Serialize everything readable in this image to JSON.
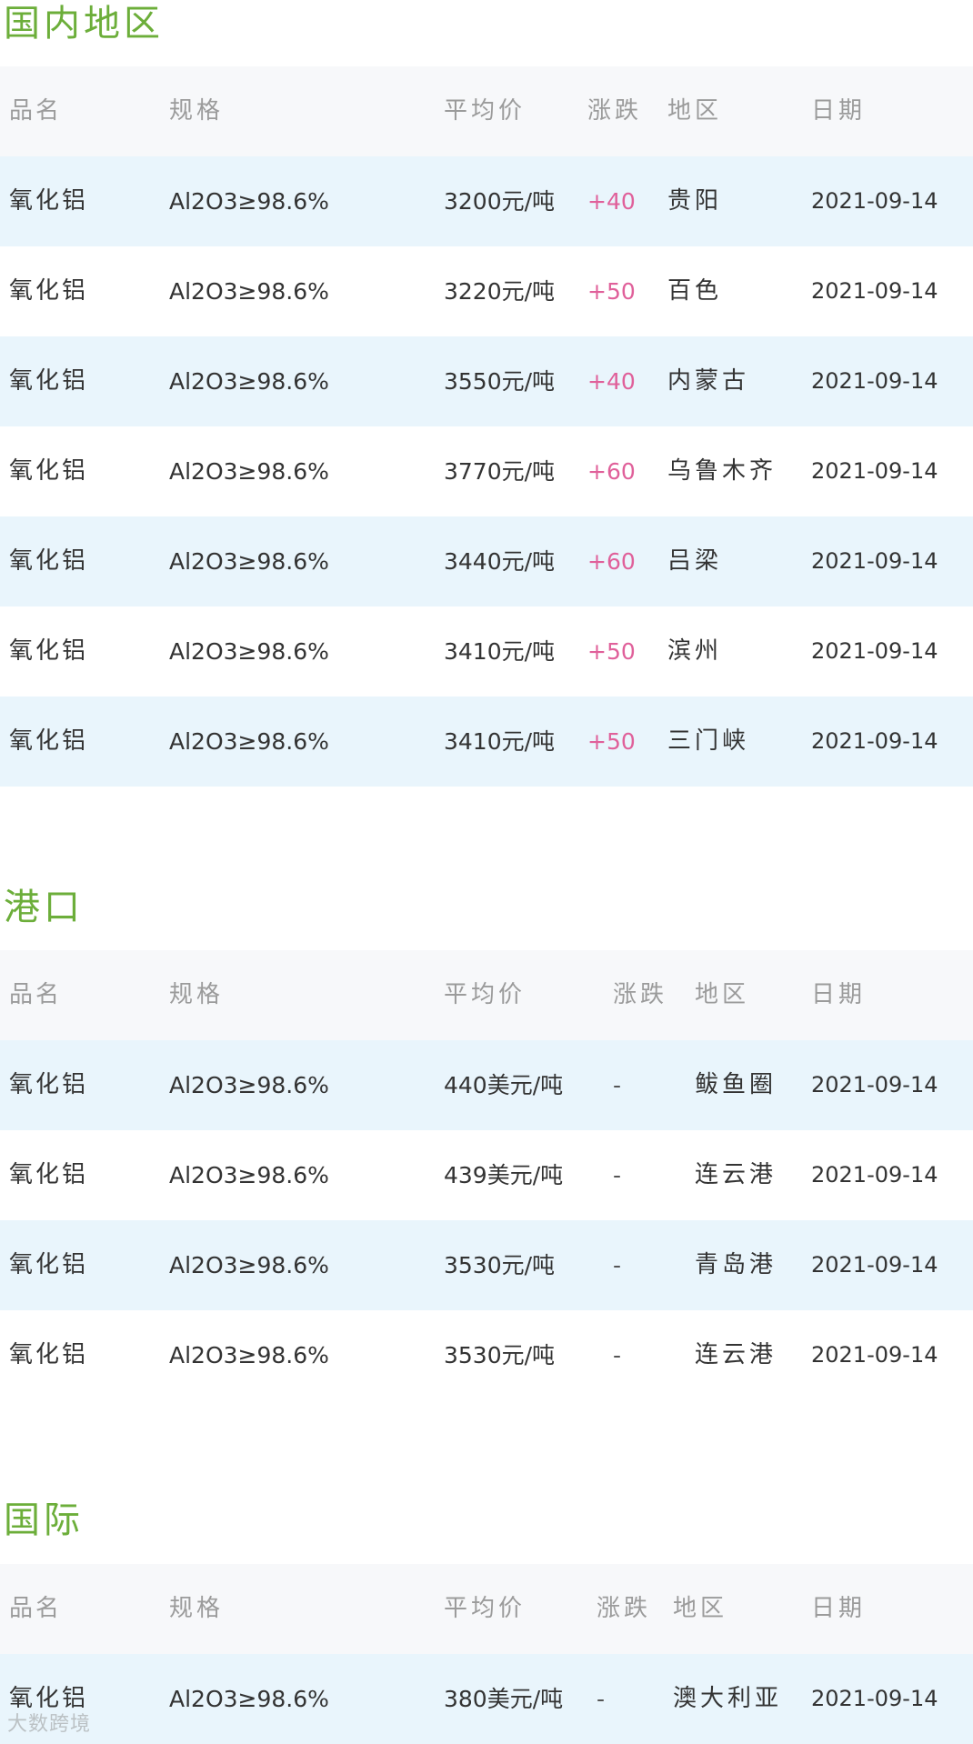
{
  "sections": [
    {
      "title": "国内地区",
      "headers": {
        "name": "品名",
        "spec": "规格",
        "price": "平均价",
        "change": "涨跌",
        "region": "地区",
        "date": "日期"
      },
      "rows": [
        {
          "name": "氧化铝",
          "spec": "Al2O3≥98.6%",
          "price": "3200元/吨",
          "change": "+40",
          "region": "贵阳",
          "date": "2021-09-14"
        },
        {
          "name": "氧化铝",
          "spec": "Al2O3≥98.6%",
          "price": "3220元/吨",
          "change": "+50",
          "region": "百色",
          "date": "2021-09-14"
        },
        {
          "name": "氧化铝",
          "spec": "Al2O3≥98.6%",
          "price": "3550元/吨",
          "change": "+40",
          "region": "内蒙古",
          "date": "2021-09-14"
        },
        {
          "name": "氧化铝",
          "spec": "Al2O3≥98.6%",
          "price": "3770元/吨",
          "change": "+60",
          "region": "乌鲁木齐",
          "date": "2021-09-14"
        },
        {
          "name": "氧化铝",
          "spec": "Al2O3≥98.6%",
          "price": "3440元/吨",
          "change": "+60",
          "region": "吕梁",
          "date": "2021-09-14"
        },
        {
          "name": "氧化铝",
          "spec": "Al2O3≥98.6%",
          "price": "3410元/吨",
          "change": "+50",
          "region": "滨州",
          "date": "2021-09-14"
        },
        {
          "name": "氧化铝",
          "spec": "Al2O3≥98.6%",
          "price": "3410元/吨",
          "change": "+50",
          "region": "三门峡",
          "date": "2021-09-14"
        }
      ]
    },
    {
      "title": "港口",
      "headers": {
        "name": "品名",
        "spec": "规格",
        "price": "平均价",
        "change": "涨跌",
        "region": "地区",
        "date": "日期"
      },
      "rows": [
        {
          "name": "氧化铝",
          "spec": "Al2O3≥98.6%",
          "price": "440美元/吨",
          "change": "-",
          "region": "鲅鱼圈",
          "date": "2021-09-14"
        },
        {
          "name": "氧化铝",
          "spec": "Al2O3≥98.6%",
          "price": "439美元/吨",
          "change": "-",
          "region": "连云港",
          "date": "2021-09-14"
        },
        {
          "name": "氧化铝",
          "spec": "Al2O3≥98.6%",
          "price": "3530元/吨",
          "change": "-",
          "region": "青岛港",
          "date": "2021-09-14"
        },
        {
          "name": "氧化铝",
          "spec": "Al2O3≥98.6%",
          "price": "3530元/吨",
          "change": "-",
          "region": "连云港",
          "date": "2021-09-14"
        }
      ]
    },
    {
      "title": "国际",
      "headers": {
        "name": "品名",
        "spec": "规格",
        "price": "平均价",
        "change": "涨跌",
        "region": "地区",
        "date": "日期"
      },
      "rows": [
        {
          "name": "氧化铝",
          "spec": "Al2O3≥98.6%",
          "price": "380美元/吨",
          "change": "-",
          "region": "澳大利亚",
          "date": "2021-09-14"
        }
      ]
    }
  ],
  "watermark": "大数跨境",
  "colors": {
    "title": "#6cae3a",
    "header_bg": "#f7f8fa",
    "row_stripe": "#e9f5fc",
    "change_up": "#e0609a"
  }
}
